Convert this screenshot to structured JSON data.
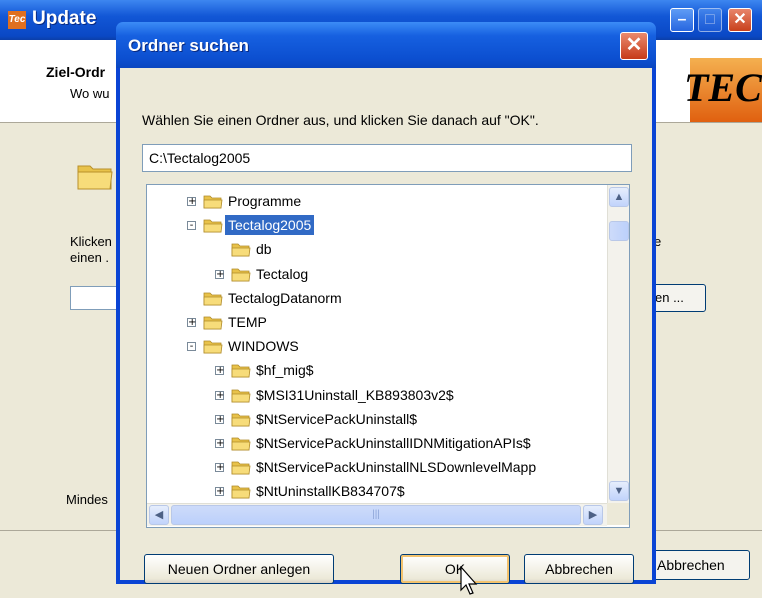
{
  "background_window": {
    "title": "Update",
    "title_icon": "Tec",
    "heading": "Ziel-Ordr",
    "subheading": "Wo wu",
    "logo_text": "TEC",
    "text_click_line1": "Klicken",
    "text_click_line2": "einen .",
    "text_right": "e",
    "browse_label": "en ...",
    "min_text": "Mindes",
    "cancel_label": "Abbrechen"
  },
  "dialog": {
    "title": "Ordner suchen",
    "instruction": "Wählen Sie einen Ordner aus, und klicken Sie danach auf \"OK\".",
    "path_value": "C:\\Tectalog2005",
    "tree": [
      {
        "label": "Programme",
        "level": 0,
        "expander": "+",
        "selected": false
      },
      {
        "label": "Tectalog2005",
        "level": 0,
        "expander": "-",
        "selected": true
      },
      {
        "label": "db",
        "level": 1,
        "expander": "",
        "selected": false
      },
      {
        "label": "Tectalog",
        "level": 1,
        "expander": "+",
        "selected": false
      },
      {
        "label": "TectalogDatanorm",
        "level": 0,
        "expander": "",
        "selected": false
      },
      {
        "label": "TEMP",
        "level": 0,
        "expander": "+",
        "selected": false
      },
      {
        "label": "WINDOWS",
        "level": 0,
        "expander": "-",
        "selected": false
      },
      {
        "label": "$hf_mig$",
        "level": 1,
        "expander": "+",
        "selected": false
      },
      {
        "label": "$MSI31Uninstall_KB893803v2$",
        "level": 1,
        "expander": "+",
        "selected": false
      },
      {
        "label": "$NtServicePackUninstall$",
        "level": 1,
        "expander": "+",
        "selected": false
      },
      {
        "label": "$NtServicePackUninstallIDNMitigationAPIs$",
        "level": 1,
        "expander": "+",
        "selected": false
      },
      {
        "label": "$NtServicePackUninstallNLSDownlevelMapp",
        "level": 1,
        "expander": "+",
        "selected": false
      },
      {
        "label": "$NtUninstallKB834707$",
        "level": 1,
        "expander": "+",
        "selected": false
      }
    ],
    "buttons": {
      "new_folder": "Neuen Ordner anlegen",
      "ok": "OK",
      "cancel": "Abbrechen"
    }
  },
  "colors": {
    "titlebar_blue": "#0a44d4",
    "selection": "#316ac5",
    "folder_yellow": "#f5d36a",
    "window_bg": "#ece9d8"
  }
}
